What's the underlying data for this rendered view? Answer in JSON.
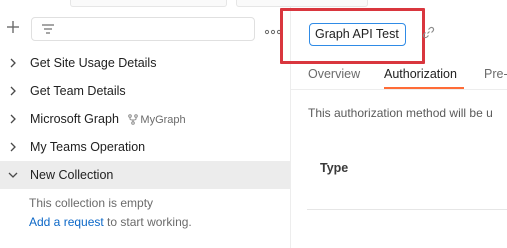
{
  "sidebar": {
    "filter_icon": "filter-lines-icon",
    "more_icon": "ellipsis-icon",
    "items": [
      {
        "label": "Get Site Usage Details",
        "expanded": false
      },
      {
        "label": "Get Team Details",
        "expanded": false
      },
      {
        "label": "Microsoft Graph",
        "expanded": false,
        "fork_label": "MyGraph"
      },
      {
        "label": "My Teams Operation",
        "expanded": false
      },
      {
        "label": "New Collection",
        "expanded": true
      }
    ],
    "empty_state": {
      "line1": "This collection is empty",
      "link_text": "Add a request",
      "line2_suffix": " to start working."
    }
  },
  "main": {
    "collection_name": "Graph API Test",
    "tabs": [
      {
        "label": "Overview",
        "active": false
      },
      {
        "label": "Authorization",
        "active": true
      },
      {
        "label": "Pre-",
        "active": false
      }
    ],
    "auth_description": "This authorization method will be u",
    "type_label": "Type"
  },
  "colors": {
    "accent": "#ff6c37",
    "link": "#0b67c7",
    "input_focus": "#2f8be6",
    "highlight": "#d9363e",
    "selected_row": "#ececec"
  }
}
